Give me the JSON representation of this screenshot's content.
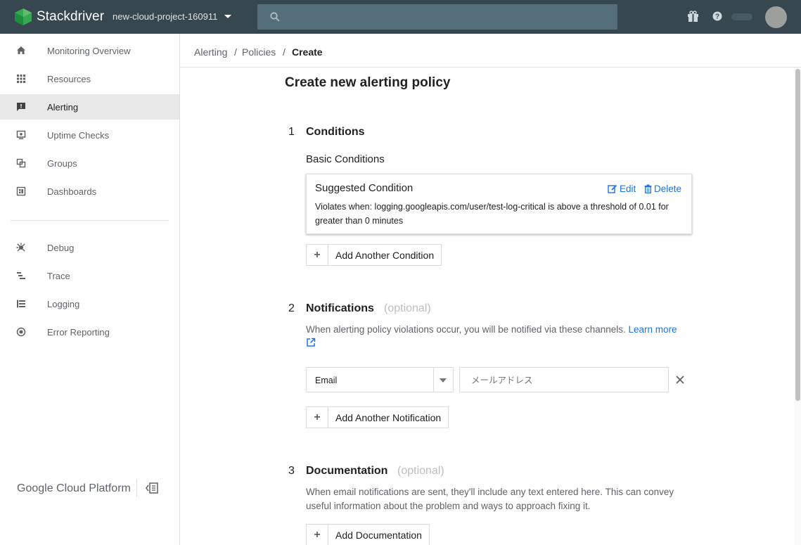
{
  "app": {
    "name": "Stackdriver",
    "project": "new-cloud-project-160911"
  },
  "colors": {
    "topbar": "#37474f",
    "accent": "#1a73e8",
    "logo_green": "#34a853"
  },
  "sidebar": {
    "items": [
      {
        "label": "Monitoring Overview",
        "icon": "home-icon"
      },
      {
        "label": "Resources",
        "icon": "grid-icon"
      },
      {
        "label": "Alerting",
        "icon": "alert-icon",
        "active": true
      },
      {
        "label": "Uptime Checks",
        "icon": "monitor-icon"
      },
      {
        "label": "Groups",
        "icon": "groups-icon"
      },
      {
        "label": "Dashboards",
        "icon": "dashboard-icon"
      },
      {
        "label": "Debug",
        "icon": "debug-icon"
      },
      {
        "label": "Trace",
        "icon": "trace-icon"
      },
      {
        "label": "Logging",
        "icon": "logging-icon"
      },
      {
        "label": "Error Reporting",
        "icon": "error-reporting-icon"
      }
    ],
    "footer": "Google Cloud Platform"
  },
  "breadcrumb": {
    "items": [
      "Alerting",
      "Policies",
      "Create"
    ]
  },
  "page": {
    "title": "Create new alerting policy"
  },
  "conditions": {
    "number": "1",
    "title": "Conditions",
    "subtitle": "Basic Conditions",
    "card": {
      "title": "Suggested Condition",
      "description": "Violates when: logging.googleapis.com/user/test-log-critical is above a threshold of 0.01 for greater than 0 minutes",
      "edit_label": "Edit",
      "delete_label": "Delete"
    },
    "add_label": "Add Another Condition"
  },
  "notifications": {
    "number": "2",
    "title": "Notifications",
    "optional": "(optional)",
    "description": "When alerting policy violations occur, you will be notified via these channels.",
    "learn_more": "Learn more",
    "channel_type": "Email",
    "address_placeholder": "メールアドレス",
    "add_label": "Add Another Notification"
  },
  "documentation": {
    "number": "3",
    "title": "Documentation",
    "optional": "(optional)",
    "description": "When email notifications are sent, they'll include any text entered here. This can convey useful information about the problem and ways to approach fixing it.",
    "add_label": "Add Documentation"
  }
}
